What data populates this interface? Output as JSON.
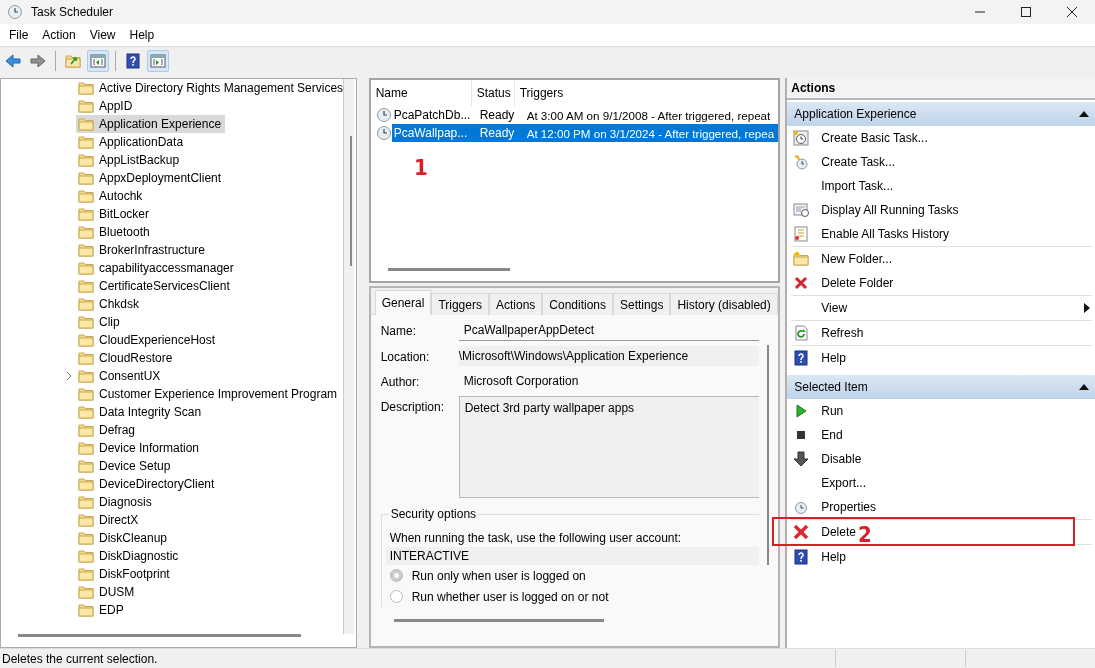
{
  "window": {
    "title": "Task Scheduler"
  },
  "menu": [
    {
      "label": "File"
    },
    {
      "label": "Action"
    },
    {
      "label": "View"
    },
    {
      "label": "Help"
    }
  ],
  "toolbar": [
    {
      "kind": "back",
      "pressed": false
    },
    {
      "kind": "forward",
      "pressed": false
    },
    {
      "kind": "up",
      "pressed": false
    },
    {
      "kind": "tree-pane",
      "pressed": true
    },
    {
      "kind": "help",
      "pressed": false
    },
    {
      "kind": "action-pane",
      "pressed": true
    }
  ],
  "tree": {
    "items": [
      {
        "label": "Active Directory Rights Management Services",
        "selected": false,
        "expander": false
      },
      {
        "label": "AppID",
        "selected": false,
        "expander": false
      },
      {
        "label": "Application Experience",
        "selected": true,
        "expander": false
      },
      {
        "label": "ApplicationData",
        "selected": false,
        "expander": false
      },
      {
        "label": "AppListBackup",
        "selected": false,
        "expander": false
      },
      {
        "label": "AppxDeploymentClient",
        "selected": false,
        "expander": false
      },
      {
        "label": "Autochk",
        "selected": false,
        "expander": false
      },
      {
        "label": "BitLocker",
        "selected": false,
        "expander": false
      },
      {
        "label": "Bluetooth",
        "selected": false,
        "expander": false
      },
      {
        "label": "BrokerInfrastructure",
        "selected": false,
        "expander": false
      },
      {
        "label": "capabilityaccessmanager",
        "selected": false,
        "expander": false
      },
      {
        "label": "CertificateServicesClient",
        "selected": false,
        "expander": false
      },
      {
        "label": "Chkdsk",
        "selected": false,
        "expander": false
      },
      {
        "label": "Clip",
        "selected": false,
        "expander": false
      },
      {
        "label": "CloudExperienceHost",
        "selected": false,
        "expander": false
      },
      {
        "label": "CloudRestore",
        "selected": false,
        "expander": false
      },
      {
        "label": "ConsentUX",
        "selected": false,
        "expander": true
      },
      {
        "label": "Customer Experience Improvement Program",
        "selected": false,
        "expander": false
      },
      {
        "label": "Data Integrity Scan",
        "selected": false,
        "expander": false
      },
      {
        "label": "Defrag",
        "selected": false,
        "expander": false
      },
      {
        "label": "Device Information",
        "selected": false,
        "expander": false
      },
      {
        "label": "Device Setup",
        "selected": false,
        "expander": false
      },
      {
        "label": "DeviceDirectoryClient",
        "selected": false,
        "expander": false
      },
      {
        "label": "Diagnosis",
        "selected": false,
        "expander": false
      },
      {
        "label": "DirectX",
        "selected": false,
        "expander": false
      },
      {
        "label": "DiskCleanup",
        "selected": false,
        "expander": false
      },
      {
        "label": "DiskDiagnostic",
        "selected": false,
        "expander": false
      },
      {
        "label": "DiskFootprint",
        "selected": false,
        "expander": false
      },
      {
        "label": "DUSM",
        "selected": false,
        "expander": false
      },
      {
        "label": "EDP",
        "selected": false,
        "expander": false
      }
    ]
  },
  "tasks": {
    "columns": [
      "Name",
      "Status",
      "Triggers"
    ],
    "rows": [
      {
        "name": "PcaPatchDb...",
        "status": "Ready",
        "triggers": "At 3:00 AM on 9/1/2008 - After triggered, repeat",
        "selected": false
      },
      {
        "name": "PcaWallpap...",
        "status": "Ready",
        "triggers": "At 12:00 PM on 3/1/2024 - After triggered, repea",
        "selected": true
      }
    ]
  },
  "details": {
    "tabs": [
      {
        "label": "General",
        "selected": true
      },
      {
        "label": "Triggers",
        "selected": false
      },
      {
        "label": "Actions",
        "selected": false
      },
      {
        "label": "Conditions",
        "selected": false
      },
      {
        "label": "Settings",
        "selected": false
      },
      {
        "label": "History (disabled)",
        "selected": false
      }
    ],
    "fields": [
      {
        "label": "Name:",
        "value": "PcaWallpaperAppDetect",
        "kind": "box"
      },
      {
        "label": "Location:",
        "value": "\\Microsoft\\Windows\\Application Experience",
        "kind": "shaded"
      },
      {
        "label": "Author:",
        "value": "Microsoft Corporation",
        "kind": "plain"
      },
      {
        "label": "Description:",
        "value": "Detect 3rd party wallpaper apps",
        "kind": "area"
      }
    ],
    "security": {
      "title": "Security options",
      "prompt": "When running the task, use the following user account:",
      "account": "INTERACTIVE",
      "options": [
        {
          "label": "Run only when user is logged on",
          "selected": true
        },
        {
          "label": "Run whether user is logged on or not",
          "selected": false
        }
      ]
    }
  },
  "actions": {
    "title": "Actions",
    "sections": [
      {
        "title": "Application Experience",
        "expanded": true,
        "items": [
          {
            "label": "Create Basic Task...",
            "kind": "basic-task",
            "separator_after": false
          },
          {
            "label": "Create Task...",
            "kind": "create-task",
            "separator_after": false
          },
          {
            "label": "Import Task...",
            "kind": "none",
            "separator_after": false
          },
          {
            "label": "Display All Running Tasks",
            "kind": "running",
            "separator_after": false
          },
          {
            "label": "Enable All Tasks History",
            "kind": "history",
            "separator_after": true
          },
          {
            "label": "New Folder...",
            "kind": "new-folder",
            "separator_after": false
          },
          {
            "label": "Delete Folder",
            "kind": "delete",
            "separator_after": true
          },
          {
            "label": "View",
            "kind": "submenu",
            "separator_after": true
          },
          {
            "label": "Refresh",
            "kind": "refresh",
            "separator_after": true
          },
          {
            "label": "Help",
            "kind": "help",
            "separator_after": false
          }
        ]
      },
      {
        "title": "Selected Item",
        "expanded": true,
        "items": [
          {
            "label": "Run",
            "kind": "run",
            "separator_after": false
          },
          {
            "label": "End",
            "kind": "end",
            "separator_after": false
          },
          {
            "label": "Disable",
            "kind": "disable",
            "separator_after": false
          },
          {
            "label": "Export...",
            "kind": "none",
            "separator_after": false
          },
          {
            "label": "Properties",
            "kind": "properties",
            "separator_after": true
          },
          {
            "label": "Delete",
            "kind": "delete-large",
            "separator_after": true
          },
          {
            "label": "Help",
            "kind": "help",
            "separator_after": false
          }
        ]
      }
    ]
  },
  "annotations": [
    {
      "label": "1",
      "boxed": false
    },
    {
      "label": "2",
      "boxed": true
    }
  ],
  "status_bar": {
    "text": "Deletes the current selection."
  }
}
